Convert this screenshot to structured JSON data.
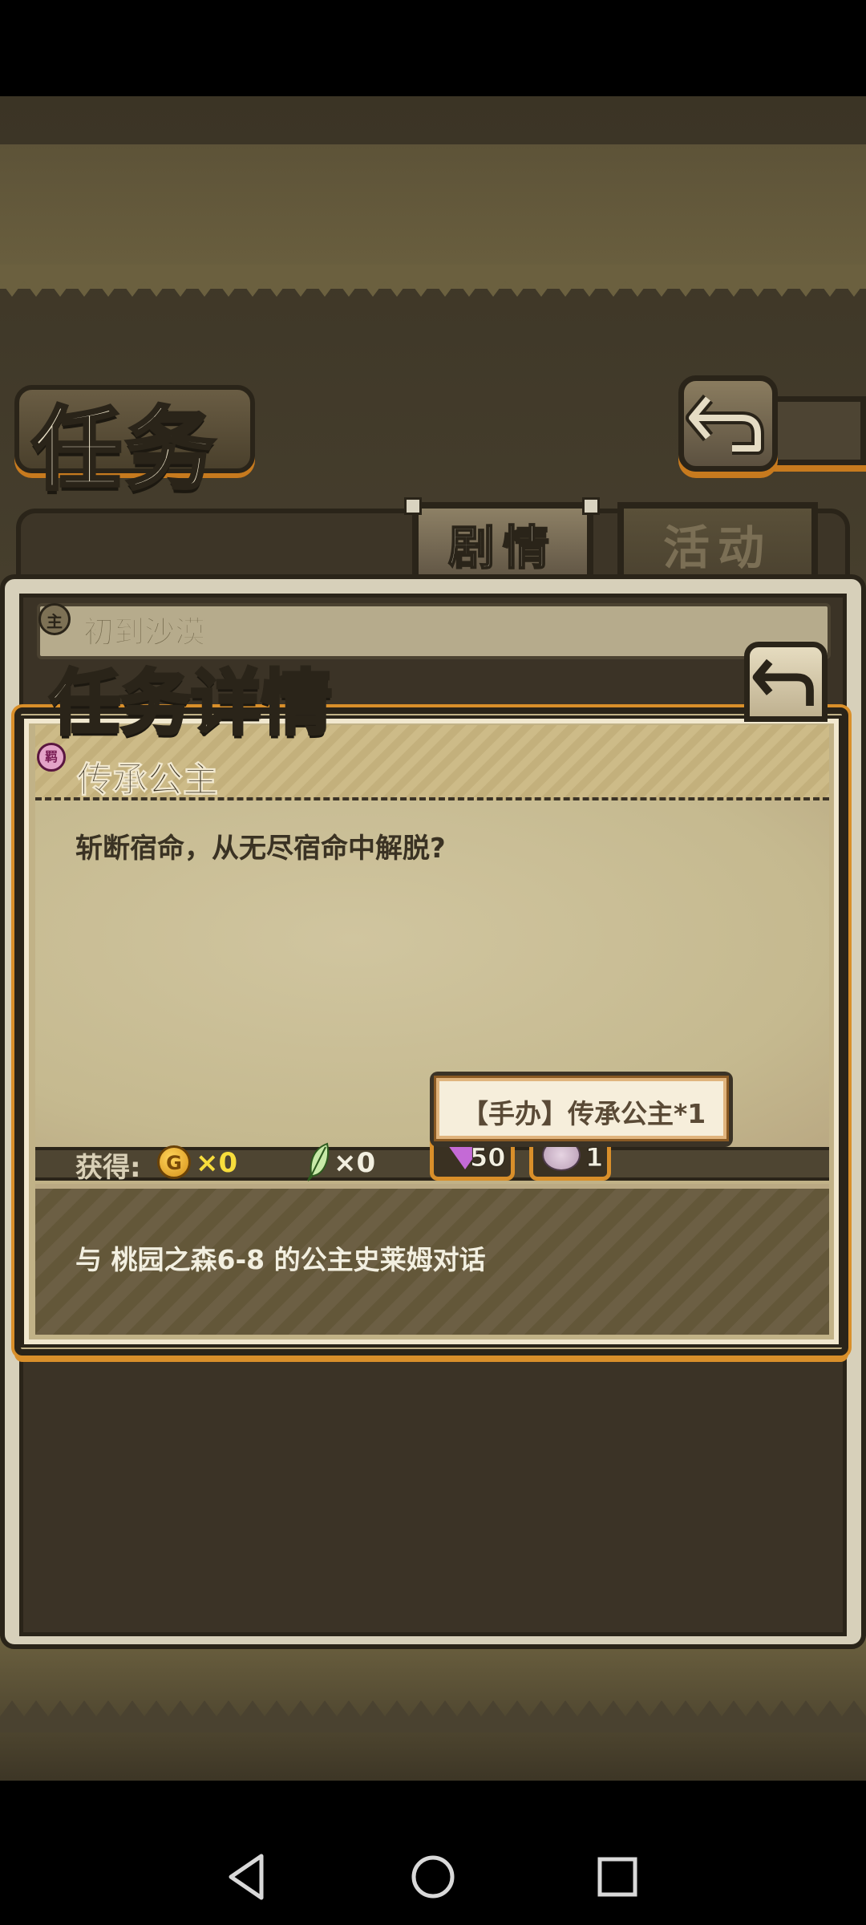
{
  "header": {
    "title": "任务"
  },
  "tabs": [
    {
      "label": "剧情",
      "active": true
    },
    {
      "label": "活动",
      "active": false
    }
  ],
  "background_mission": {
    "tag": "主",
    "title": "初到沙漠"
  },
  "dialog": {
    "title": "任务详情",
    "mission": {
      "tag": "羁",
      "title": "传承公主",
      "description": "斩断宿命，从无尽宿命中解脱?"
    },
    "rewards": {
      "label": "获得:",
      "gold_icon": "G",
      "gold": "×0",
      "feather": "×0",
      "gems": "50",
      "figurine": "1"
    },
    "tooltip": "【手办】传承公主*1",
    "objective": "与 桃园之森6-8 的公主史莱姆对话"
  },
  "icons": {
    "back": "return-arrow-icon",
    "gold": "gold-coin-icon",
    "feather": "feather-icon",
    "gem": "gem-icon",
    "figurine": "figurine-icon"
  },
  "colors": {
    "accent_orange": "#d98f2a",
    "gold_text": "#f7dd3c",
    "dark_outline": "#2a2419"
  }
}
